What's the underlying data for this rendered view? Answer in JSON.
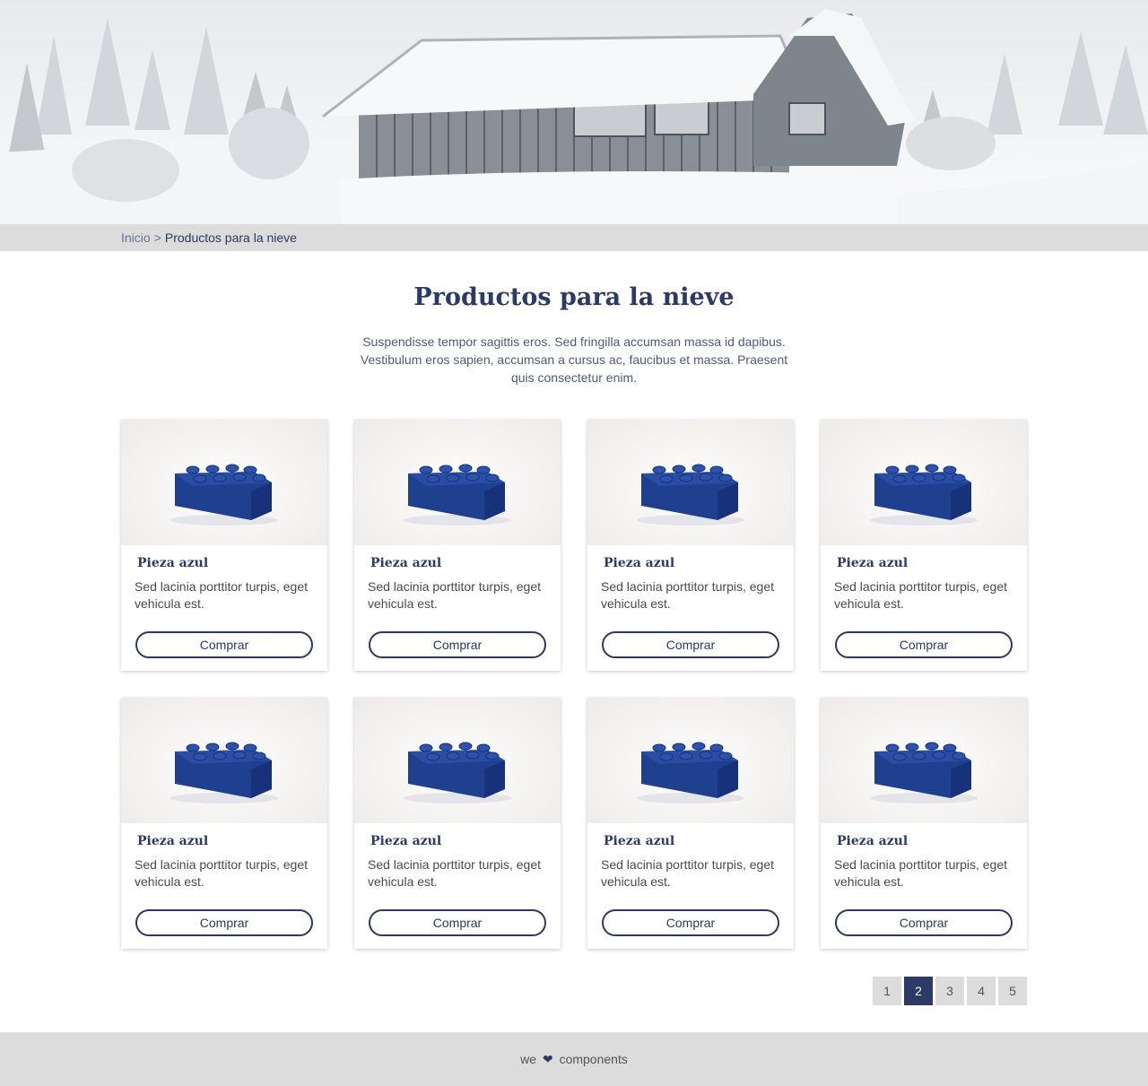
{
  "breadcrumb": {
    "home": "Inicio",
    "separator": ">",
    "current": "Productos para la nieve"
  },
  "page": {
    "title": "Productos para la nieve",
    "intro": "Suspendisse tempor sagittis eros. Sed fringilla accumsan massa id dapibus. Vestibulum eros sapien, accumsan a cursus ac, faucibus et massa. Praesent quis consectetur enim."
  },
  "products": [
    {
      "name": "Pieza azul",
      "description": "Sed lacinia porttitor turpis, eget vehicula est.",
      "button": "Comprar"
    },
    {
      "name": "Pieza azul",
      "description": "Sed lacinia porttitor turpis, eget vehicula est.",
      "button": "Comprar"
    },
    {
      "name": "Pieza azul",
      "description": "Sed lacinia porttitor turpis, eget vehicula est.",
      "button": "Comprar"
    },
    {
      "name": "Pieza azul",
      "description": "Sed lacinia porttitor turpis, eget vehicula est.",
      "button": "Comprar"
    },
    {
      "name": "Pieza azul",
      "description": "Sed lacinia porttitor turpis, eget vehicula est.",
      "button": "Comprar"
    },
    {
      "name": "Pieza azul",
      "description": "Sed lacinia porttitor turpis, eget vehicula est.",
      "button": "Comprar"
    },
    {
      "name": "Pieza azul",
      "description": "Sed lacinia porttitor turpis, eget vehicula est.",
      "button": "Comprar"
    },
    {
      "name": "Pieza azul",
      "description": "Sed lacinia porttitor turpis, eget vehicula est.",
      "button": "Comprar"
    }
  ],
  "pagination": {
    "pages": [
      "1",
      "2",
      "3",
      "4",
      "5"
    ],
    "current": "2"
  },
  "footer": {
    "prefix": "we",
    "heart": "❤",
    "suffix": "components"
  },
  "colors": {
    "brand": "#2b3a66",
    "brick": "#1f3f8f",
    "footer_bg": "#dcdcdc"
  },
  "icons": {
    "hero": "snowy-cabin-image",
    "product": "blue-brick-image"
  }
}
